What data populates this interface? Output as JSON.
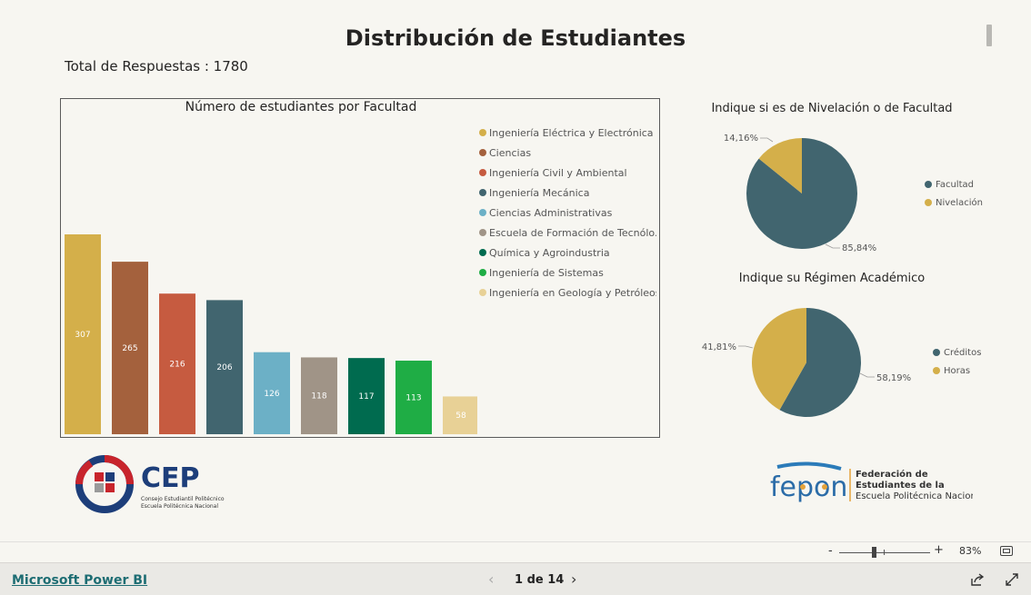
{
  "report": {
    "title": "Distribución de Estudiantes",
    "total_label": "Total de Respuestas : 1780"
  },
  "colors": {
    "background": "#f7f6f1",
    "yellow": "#d4af4a",
    "brown": "#a4613d",
    "red": "#c65b40",
    "slate": "#41656f",
    "light_blue": "#6cb0c6",
    "taupe": "#a09487",
    "dark_green": "#006b4f",
    "green": "#1fad45",
    "sand": "#e8d196"
  },
  "chart_data": [
    {
      "type": "bar",
      "title": "Número de estudiantes por Facultad",
      "categories": [
        "Ingeniería Eléctrica y Electrónica",
        "Ciencias",
        "Ingeniería Civil y Ambiental",
        "Ingeniería Mecánica",
        "Ciencias Administrativas",
        "Escuela de Formación de Tecnólo...",
        "Química y Agroindustria",
        "Ingeniería de Sistemas",
        "Ingeniería en Geología y Petróleos"
      ],
      "values": [
        307,
        265,
        216,
        206,
        126,
        118,
        117,
        113,
        58
      ],
      "colors": [
        "#d4af4a",
        "#a4613d",
        "#c65b40",
        "#41656f",
        "#6cb0c6",
        "#a09487",
        "#006b4f",
        "#1fad45",
        "#e8d196"
      ],
      "ylim": [
        0,
        330
      ],
      "legend": "top-right",
      "grid": false
    },
    {
      "type": "pie",
      "title": "Indique si es de Nivelación o de Facultad",
      "categories": [
        "Facultad",
        "Nivelación"
      ],
      "values": [
        85.84,
        14.16
      ],
      "labels": [
        "85,84%",
        "14,16%"
      ],
      "colors": [
        "#41656f",
        "#d4af4a"
      ],
      "legend": "right"
    },
    {
      "type": "pie",
      "title": "Indique su Régimen Académico",
      "categories": [
        "Créditos",
        "Horas"
      ],
      "values": [
        58.19,
        41.81
      ],
      "labels": [
        "58,19%",
        "41,81%"
      ],
      "colors": [
        "#41656f",
        "#d4af4a"
      ],
      "legend": "right"
    }
  ],
  "logos": {
    "cep": {
      "text": "CEP",
      "line1": "Consejo Estudiantil Politécnico",
      "line2": "Escuela Politécnica Nacional"
    },
    "fepon": {
      "text": "fepon",
      "line1": "Federación de",
      "line2": "Estudiantes de la",
      "line3": "Escuela Politécnica Nacional"
    }
  },
  "zoom": {
    "minus": "-",
    "plus": "+",
    "level": "83%",
    "value_percent": 83,
    "icon": "fit-to-page-icon"
  },
  "footer": {
    "link": "Microsoft Power BI",
    "prev_icon": "chevron-left-icon",
    "next_icon": "chevron-right-icon",
    "prev": "‹",
    "next": "›",
    "page": "1 de 14",
    "share_icon": "share-icon",
    "expand_icon": "expand-icon"
  }
}
